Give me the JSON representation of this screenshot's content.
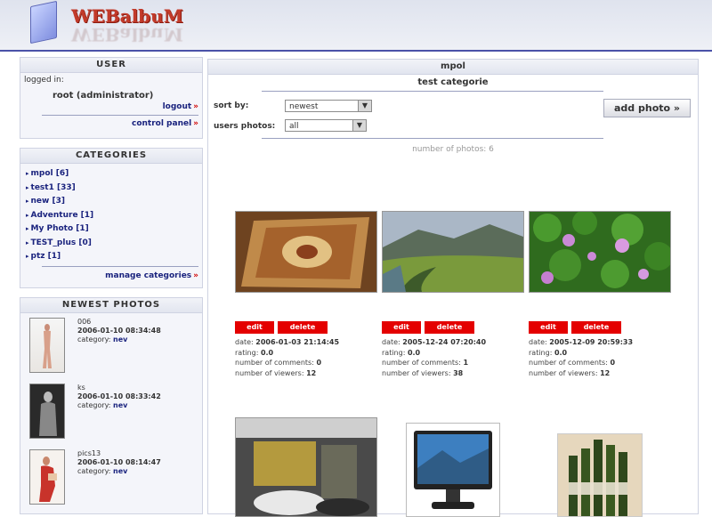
{
  "app": {
    "logo_text": "WEBalbuM"
  },
  "user_panel": {
    "title": "USER",
    "logged_in_label": "logged in:",
    "user_name": "root (administrator)",
    "logout": "logout",
    "control_panel": "control panel",
    "arrow": "»"
  },
  "categories_panel": {
    "title": "CATEGORIES",
    "items": [
      {
        "label": "mpol [6]"
      },
      {
        "label": "test1 [33]"
      },
      {
        "label": "new [3]"
      },
      {
        "label": "Adventure [1]"
      },
      {
        "label": "My Photo [1]"
      },
      {
        "label": "TEST_plus [0]"
      },
      {
        "label": "ptz [1]"
      }
    ],
    "manage": "manage categories"
  },
  "newest_panel": {
    "title": "NEWEST PHOTOS",
    "category_label": "category:",
    "items": [
      {
        "name": "006",
        "datetime": "2006-01-10 08:34:48",
        "category": "nev"
      },
      {
        "name": "ks",
        "datetime": "2006-01-10 08:33:42",
        "category": "nev"
      },
      {
        "name": "pics13",
        "datetime": "2006-01-10 08:14:47",
        "category": "nev"
      }
    ]
  },
  "main": {
    "user": "mpol",
    "category": "test categorie",
    "sort_label": "sort by:",
    "sort_value": "newest",
    "users_label": "users photos:",
    "users_value": "all",
    "add_photo": "add photo »",
    "count_label": "number of photos:",
    "count_value": "6"
  },
  "photo_labels": {
    "edit": "edit",
    "delete": "delete",
    "date": "date:",
    "rating": "rating:",
    "comments": "number of comments:",
    "viewers": "number of viewers:"
  },
  "photos": [
    {
      "date": "2006-01-03 21:14:45",
      "rating": "0.0",
      "comments": "0",
      "viewers": "12"
    },
    {
      "date": "2005-12-24 07:20:40",
      "rating": "0.0",
      "comments": "1",
      "viewers": "38"
    },
    {
      "date": "2005-12-09 20:59:33",
      "rating": "0.0",
      "comments": "0",
      "viewers": "12"
    }
  ],
  "colors": {
    "accent": "#1a237e",
    "button_red": "#e40000",
    "header_rule": "#4a52a8"
  }
}
